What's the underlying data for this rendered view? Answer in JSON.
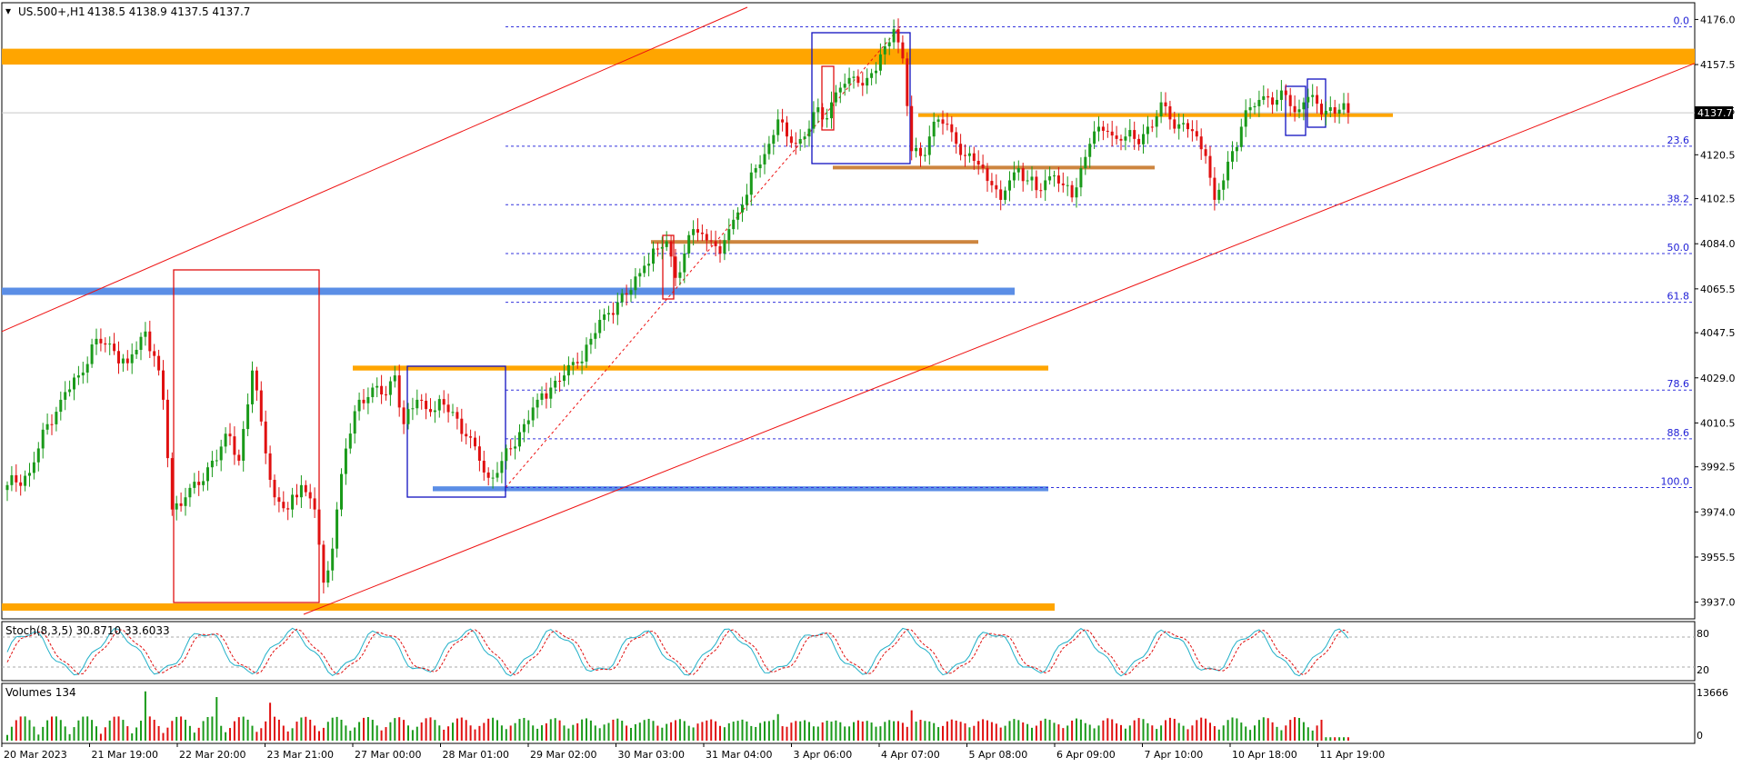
{
  "header": {
    "title": "US.500+,H1",
    "ohlc": "4138.5 4138.9 4137.5 4137.7"
  },
  "colors": {
    "up": "#1a9a1a",
    "down": "#e01010",
    "orange_zone": "#ffa500",
    "blue_zone": "#5b8ee6",
    "brown_zone": "#cd853f",
    "channel": "#ee1111",
    "fib": "#3333dd",
    "stoch_main": "#20b0c8",
    "stoch_signal": "#e01010"
  },
  "price_axis": {
    "ticks": [
      "4176.0",
      "4157.5",
      "4138.5",
      "4120.5",
      "4102.5",
      "4084.0",
      "4065.5",
      "4047.5",
      "4029.0",
      "4010.5",
      "3992.5",
      "3974.0",
      "3955.5",
      "3937.0"
    ],
    "current_price": "4137.7",
    "min": 3932,
    "max": 4181
  },
  "time_axis": {
    "labels": [
      "20 Mar 2023",
      "21 Mar 19:00",
      "22 Mar 20:00",
      "23 Mar 21:00",
      "27 Mar 00:00",
      "28 Mar 01:00",
      "29 Mar 02:00",
      "30 Mar 03:00",
      "31 Mar 04:00",
      "3 Apr 06:00",
      "4 Apr 07:00",
      "5 Apr 08:00",
      "6 Apr 09:00",
      "7 Apr 10:00",
      "10 Apr 18:00",
      "11 Apr 19:00"
    ]
  },
  "fibonacci": {
    "levels": [
      {
        "label": "0.0",
        "price": 4173
      },
      {
        "label": "23.6",
        "price": 4124
      },
      {
        "label": "38.2",
        "price": 4100
      },
      {
        "label": "50.0",
        "price": 4080
      },
      {
        "label": "61.8",
        "price": 4060
      },
      {
        "label": "78.6",
        "price": 4024
      },
      {
        "label": "88.6",
        "price": 4004
      },
      {
        "label": "100.0",
        "price": 3984
      }
    ]
  },
  "stochastic": {
    "label": "Stoch(8,3,5) 30.8710 33.6033",
    "levels": [
      "80",
      "20"
    ],
    "max": 100,
    "min": 0
  },
  "volumes": {
    "label": "Volumes 134",
    "max_label": "13666",
    "zero_label": "0",
    "max": 13666
  },
  "chart_data": {
    "type": "candlestick",
    "symbol": "US.500+",
    "timeframe": "H1",
    "title": "US.500+,H1",
    "y_range": [
      3932,
      4181
    ],
    "anchors": [
      [
        0,
        3985
      ],
      [
        5,
        3990
      ],
      [
        9,
        4010
      ],
      [
        12,
        4020
      ],
      [
        16,
        4030
      ],
      [
        20,
        4045
      ],
      [
        24,
        4040
      ],
      [
        27,
        4035
      ],
      [
        31,
        4048
      ],
      [
        33,
        4038
      ],
      [
        35,
        4020
      ],
      [
        37,
        3975
      ],
      [
        40,
        3980
      ],
      [
        43,
        3985
      ],
      [
        46,
        3995
      ],
      [
        50,
        4005
      ],
      [
        52,
        3995
      ],
      [
        55,
        4032
      ],
      [
        58,
        3998
      ],
      [
        60,
        3980
      ],
      [
        63,
        3975
      ],
      [
        66,
        3985
      ],
      [
        69,
        3975
      ],
      [
        71,
        3945
      ],
      [
        72,
        3950
      ],
      [
        74,
        3975
      ],
      [
        76,
        4000
      ],
      [
        79,
        4020
      ],
      [
        82,
        4025
      ],
      [
        85,
        4022
      ],
      [
        87,
        4030
      ],
      [
        89,
        4010
      ],
      [
        92,
        4020
      ],
      [
        95,
        4015
      ],
      [
        98,
        4018
      ],
      [
        100,
        4015
      ],
      [
        103,
        4005
      ],
      [
        106,
        3995
      ],
      [
        108,
        3988
      ],
      [
        110,
        3990
      ],
      [
        113,
        4000
      ],
      [
        116,
        4010
      ],
      [
        119,
        4020
      ],
      [
        122,
        4025
      ],
      [
        125,
        4030
      ],
      [
        128,
        4035
      ],
      [
        131,
        4045
      ],
      [
        134,
        4055
      ],
      [
        137,
        4060
      ],
      [
        140,
        4065
      ],
      [
        143,
        4075
      ],
      [
        146,
        4082
      ],
      [
        148,
        4085
      ],
      [
        150,
        4070
      ],
      [
        152,
        4080
      ],
      [
        154,
        4090
      ],
      [
        156,
        4088
      ],
      [
        158,
        4085
      ],
      [
        160,
        4080
      ],
      [
        162,
        4090
      ],
      [
        165,
        4100
      ],
      [
        168,
        4115
      ],
      [
        171,
        4125
      ],
      [
        173,
        4135
      ],
      [
        175,
        4128
      ],
      [
        177,
        4125
      ],
      [
        179,
        4128
      ],
      [
        181,
        4138
      ],
      [
        183,
        4135
      ],
      [
        185,
        4142
      ],
      [
        187,
        4148
      ],
      [
        189,
        4152
      ],
      [
        191,
        4150
      ],
      [
        193,
        4152
      ],
      [
        195,
        4155
      ],
      [
        197,
        4165
      ],
      [
        199,
        4172
      ],
      [
        201,
        4160
      ],
      [
        203,
        4122
      ],
      [
        205,
        4120
      ],
      [
        207,
        4128
      ],
      [
        209,
        4135
      ],
      [
        211,
        4133
      ],
      [
        213,
        4125
      ],
      [
        215,
        4120
      ],
      [
        217,
        4118
      ],
      [
        219,
        4115
      ],
      [
        221,
        4108
      ],
      [
        223,
        4102
      ],
      [
        225,
        4110
      ],
      [
        227,
        4115
      ],
      [
        229,
        4110
      ],
      [
        231,
        4106
      ],
      [
        233,
        4110
      ],
      [
        235,
        4112
      ],
      [
        237,
        4108
      ],
      [
        239,
        4103
      ],
      [
        241,
        4115
      ],
      [
        243,
        4125
      ],
      [
        245,
        4132
      ],
      [
        247,
        4130
      ],
      [
        249,
        4127
      ],
      [
        251,
        4128
      ],
      [
        253,
        4127
      ],
      [
        255,
        4129
      ],
      [
        257,
        4132
      ],
      [
        259,
        4142
      ],
      [
        261,
        4135
      ],
      [
        263,
        4133
      ],
      [
        265,
        4131
      ],
      [
        267,
        4128
      ],
      [
        269,
        4120
      ],
      [
        271,
        4102
      ],
      [
        273,
        4110
      ],
      [
        275,
        4122
      ],
      [
        277,
        4132
      ],
      [
        279,
        4140
      ],
      [
        281,
        4143
      ],
      [
        283,
        4144
      ],
      [
        285,
        4143
      ],
      [
        287,
        4145
      ],
      [
        289,
        4138
      ],
      [
        291,
        4142
      ],
      [
        293,
        4145
      ],
      [
        295,
        4137
      ],
      [
        297,
        4140
      ],
      [
        299,
        4139
      ],
      [
        301,
        4137.7
      ]
    ],
    "annotations": [
      "orange supply zone near 4157-4164",
      "orange demand zone near 3933-3936",
      "fibonacci retracement 0.0 to 100.0"
    ]
  }
}
